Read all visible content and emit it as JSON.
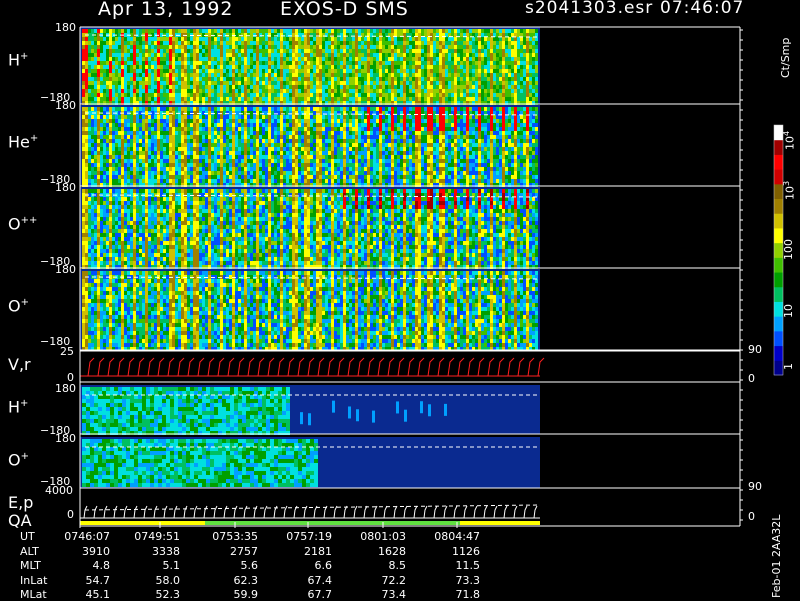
{
  "header": {
    "date": "Apr 13, 1992",
    "instrument": "EXOS-D SMS",
    "file": "s2041303.esr",
    "time": "07:46:07"
  },
  "colorbar": {
    "unit": "Ct/Smp",
    "ticks": [
      "1",
      "10",
      "100",
      "10",
      "10"
    ],
    "tick_exponents": [
      "",
      "",
      "",
      "3",
      "4"
    ],
    "colors": [
      "#00008c",
      "#0000c8",
      "#0050ff",
      "#00a0ff",
      "#00e0e0",
      "#00c060",
      "#00a000",
      "#40c000",
      "#90d000",
      "#ffff00",
      "#d0c000",
      "#a08000",
      "#806000",
      "#d00000",
      "#ff0000",
      "#a00000",
      "#ffffff"
    ]
  },
  "panels": [
    {
      "label": "H",
      "sup": "+",
      "ymax": "180",
      "ymin": "−180"
    },
    {
      "label": "He",
      "sup": "+",
      "ymax": "180",
      "ymin": "−180"
    },
    {
      "label": "O",
      "sup": "++",
      "ymax": "180",
      "ymin": "−180"
    },
    {
      "label": "O",
      "sup": "+",
      "ymax": "180",
      "ymin": "−180"
    }
  ],
  "vr_panel": {
    "label": "V,r",
    "ymax": "25",
    "ymin": "0",
    "right_top": "90",
    "right_bottom": "0"
  },
  "small_panels": [
    {
      "label": "H",
      "sup": "+",
      "ymax": "180",
      "ymin": "−180"
    },
    {
      "label": "O",
      "sup": "+",
      "ymax": "180",
      "ymin": "−180"
    }
  ],
  "ep_panel": {
    "label": "E,p",
    "label2": "QA",
    "ymax": "4000",
    "ymin": "0",
    "right_top": "90",
    "right_bottom": "0"
  },
  "footer": {
    "rows": [
      {
        "name": "UT",
        "values": [
          "0746:07",
          "0749:51",
          "0753:35",
          "0757:19",
          "0801:03",
          "0804:47"
        ]
      },
      {
        "name": "ALT",
        "values": [
          "3910",
          "3338",
          "2757",
          "2181",
          "1628",
          "1126"
        ]
      },
      {
        "name": "MLT",
        "values": [
          "4.8",
          "5.1",
          "5.6",
          "6.6",
          "8.5",
          "11.5"
        ]
      },
      {
        "name": "InLat",
        "values": [
          "54.7",
          "58.0",
          "62.3",
          "67.4",
          "72.2",
          "73.3"
        ]
      },
      {
        "name": "MLat",
        "values": [
          "45.1",
          "52.3",
          "59.9",
          "67.7",
          "73.4",
          "71.8"
        ]
      }
    ],
    "side_note": "Feb-01 2AA32L"
  },
  "chart_data": {
    "type": "heatmap",
    "title": "Apr 13, 1992 EXOS-D SMS",
    "colorbar_label": "Ct/Smp",
    "colorbar_scale": "log",
    "colorbar_range": [
      1,
      10000
    ],
    "series": [
      {
        "name": "H+",
        "y_range": [
          -180,
          180
        ]
      },
      {
        "name": "He+",
        "y_range": [
          -180,
          180
        ]
      },
      {
        "name": "O++",
        "y_range": [
          -180,
          180
        ]
      },
      {
        "name": "O+",
        "y_range": [
          -180,
          180
        ]
      },
      {
        "name": "V,r",
        "y_range": [
          0,
          25
        ],
        "y2_range": [
          0,
          90
        ]
      },
      {
        "name": "H+",
        "y_range": [
          -180,
          180
        ]
      },
      {
        "name": "O+",
        "y_range": [
          -180,
          180
        ]
      },
      {
        "name": "E,p",
        "y_range": [
          0,
          4000
        ],
        "y2_range": [
          0,
          90
        ]
      }
    ],
    "x_ticks_ut": [
      "0746:07",
      "0749:51",
      "0753:35",
      "0757:19",
      "0801:03",
      "0804:47"
    ]
  }
}
